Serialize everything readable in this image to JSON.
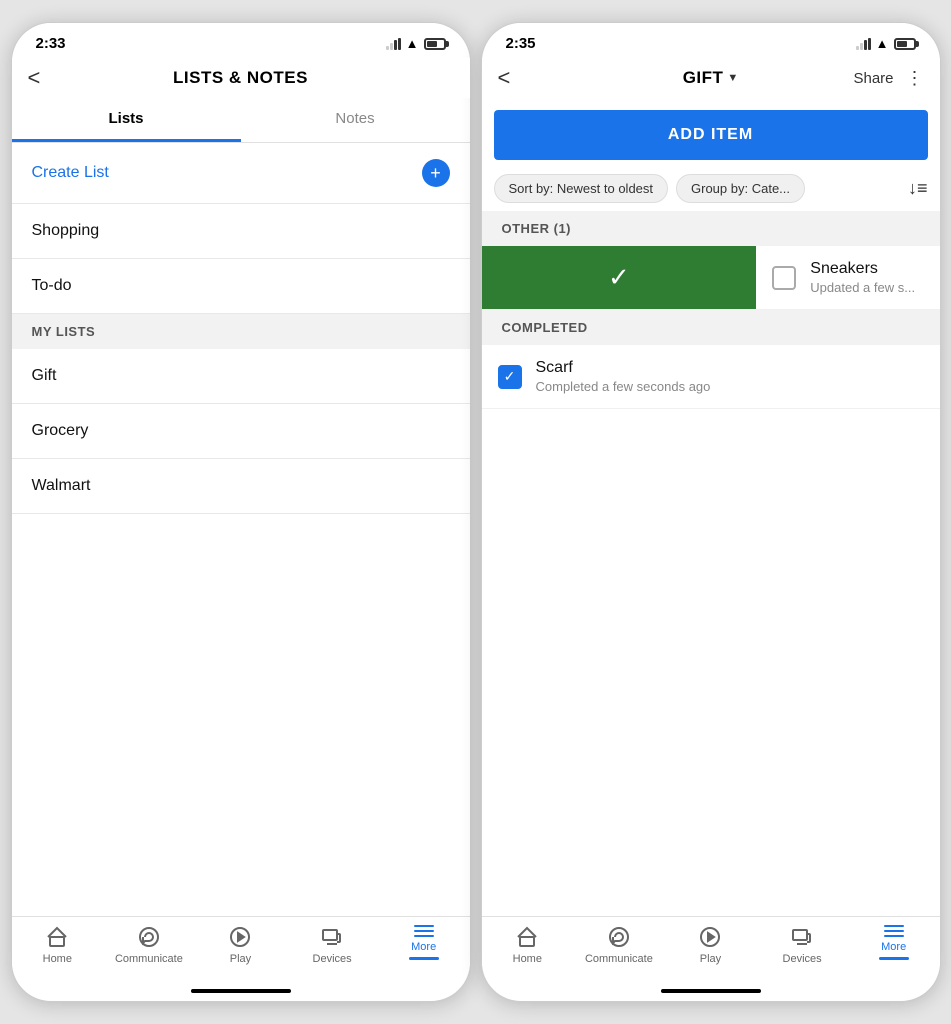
{
  "phone1": {
    "status": {
      "time": "2:33",
      "location_arrow": "➤"
    },
    "header": {
      "back": "<",
      "title": "LISTS & NOTES"
    },
    "tabs": [
      {
        "label": "Lists",
        "active": true
      },
      {
        "label": "Notes",
        "active": false
      }
    ],
    "create_list": {
      "text": "Create List",
      "btn": "+"
    },
    "default_lists": [
      {
        "name": "Shopping"
      },
      {
        "name": "To-do"
      }
    ],
    "my_lists_section": "MY LISTS",
    "my_lists": [
      {
        "name": "Gift"
      },
      {
        "name": "Grocery"
      },
      {
        "name": "Walmart"
      }
    ],
    "bottom_nav": [
      {
        "label": "Home",
        "icon": "home",
        "active": false
      },
      {
        "label": "Communicate",
        "icon": "communicate",
        "active": false
      },
      {
        "label": "Play",
        "icon": "play",
        "active": false
      },
      {
        "label": "Devices",
        "icon": "devices",
        "active": false
      },
      {
        "label": "More",
        "icon": "more",
        "active": true
      }
    ]
  },
  "phone2": {
    "status": {
      "time": "2:35",
      "location_arrow": "➤"
    },
    "header": {
      "back": "<",
      "title": "GIFT",
      "share": "Share",
      "dots": "⋮"
    },
    "add_item_btn": "ADD ITEM",
    "filters": [
      {
        "label": "Sort by: Newest to oldest"
      },
      {
        "label": "Group by: Cate..."
      }
    ],
    "sort_icon": "↓≡",
    "sections": [
      {
        "name": "OTHER (1)",
        "items": [
          {
            "name": "Sneakers",
            "sub": "Updated a few s...",
            "checked": false,
            "swiped": true
          }
        ]
      },
      {
        "name": "COMPLETED",
        "items": [
          {
            "name": "Scarf",
            "sub": "Completed a few seconds ago",
            "checked": true,
            "swiped": false
          }
        ]
      }
    ],
    "bottom_nav": [
      {
        "label": "Home",
        "icon": "home",
        "active": false
      },
      {
        "label": "Communicate",
        "icon": "communicate",
        "active": false
      },
      {
        "label": "Play",
        "icon": "play",
        "active": false
      },
      {
        "label": "Devices",
        "icon": "devices",
        "active": false
      },
      {
        "label": "More",
        "icon": "more",
        "active": true
      }
    ]
  }
}
